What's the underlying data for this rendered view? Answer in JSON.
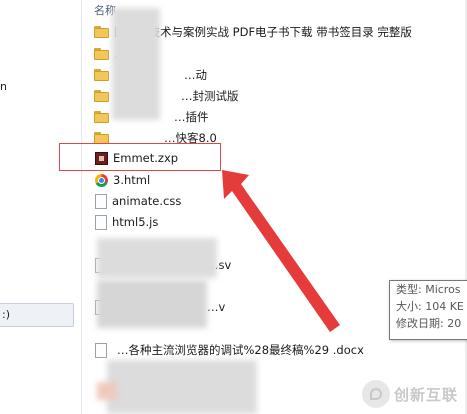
{
  "nav": {
    "fragment_item": "n",
    "selected_item": ":)"
  },
  "file_list": {
    "column_name": "名称",
    "rows": [
      {
        "type": "folder",
        "name": "图…心技术与案例实战 PDF电子书下载 带书签目录 完整版"
      },
      {
        "type": "folder",
        "name": "…"
      },
      {
        "type": "folder",
        "name": "…动"
      },
      {
        "type": "folder",
        "name": "…封测试版"
      },
      {
        "type": "folder",
        "name": "…插件"
      },
      {
        "type": "folder",
        "name": "…快客8.0"
      },
      {
        "type": "zxp",
        "name": "Emmet.zxp"
      },
      {
        "type": "chrome",
        "name": "3.html"
      },
      {
        "type": "doc",
        "name": "animate.css"
      },
      {
        "type": "doc",
        "name": "html5.js"
      },
      {
        "type": "doc",
        "name": "…sv"
      },
      {
        "type": "doc",
        "name": "…v"
      },
      {
        "type": "doc",
        "name": "…各种主流浏览器的调试%28最终稿%29 .docx"
      }
    ]
  },
  "tooltip": {
    "line1": "类型: Micros",
    "line2": "大小: 104 KE",
    "line3": "修改日期: 20"
  },
  "watermark": {
    "text": "创新互联"
  },
  "colors": {
    "highlight": "#e04848",
    "arrow": "#e53b3b"
  }
}
